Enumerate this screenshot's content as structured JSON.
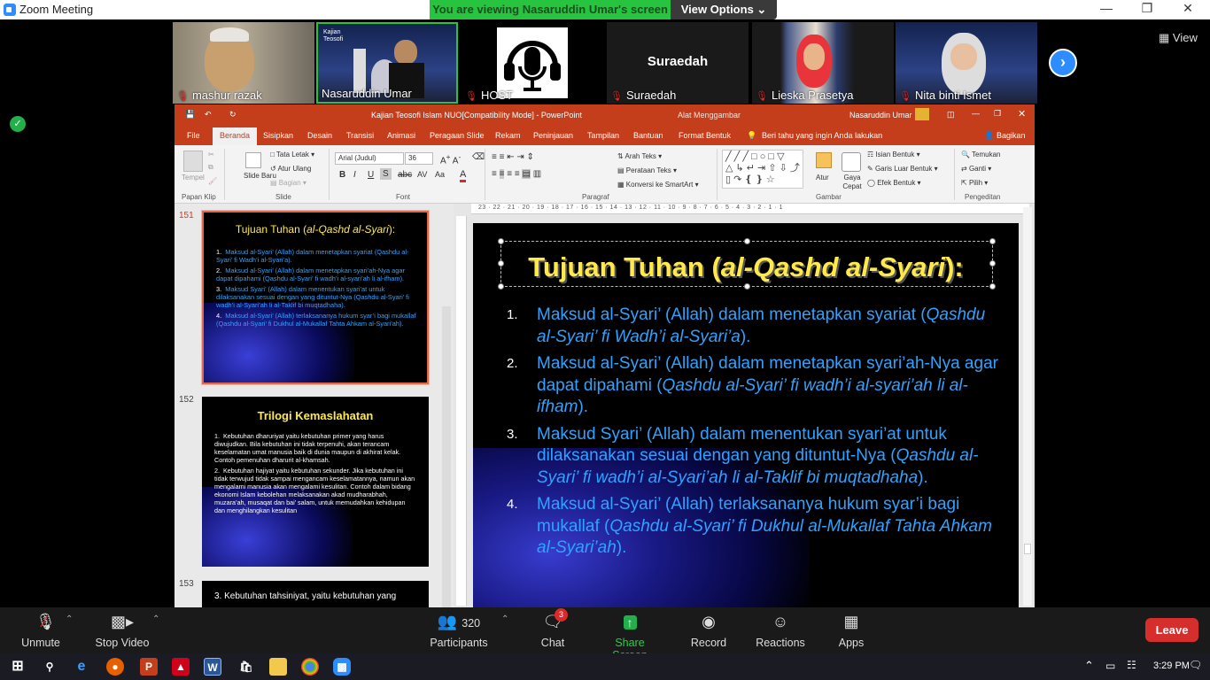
{
  "window": {
    "title": "Zoom Meeting"
  },
  "banner": {
    "viewing": "You are viewing Nasaruddin Umar's screen",
    "view_options": "View Options ⌄"
  },
  "participants_strip": [
    {
      "name": "mashur razak"
    },
    {
      "name": "Nasaruddin Umar"
    },
    {
      "name": "HOST"
    },
    {
      "name": "Suraedah",
      "big_label": "Suraedah"
    },
    {
      "name": "Lieska Prasetya"
    },
    {
      "name": "Nita binti Ismet"
    }
  ],
  "view_label": "View",
  "powerpoint": {
    "doc_title": "Kajian Teosofi Islam NUO[Compatibility Mode]  -  PowerPoint",
    "context_label": "Alat Menggambar",
    "user": "Nasaruddin Umar",
    "tabs": [
      "File",
      "Beranda",
      "Sisipkan",
      "Desain",
      "Transisi",
      "Animasi",
      "Peragaan Slide",
      "Rekam",
      "Peninjauan",
      "Tampilan",
      "Bantuan",
      "Format Bentuk"
    ],
    "tell_me": "Beri tahu yang ingin Anda lakukan",
    "share": "Bagikan",
    "ribbon": {
      "paste": "Tempel",
      "clipboard": "Papan Klip",
      "new_slide": "Slide Baru",
      "layout": "Tata Letak",
      "reset": "Atur Ulang",
      "section": "Bagian",
      "slide_group": "Slide",
      "font_name": "Arial (Judul)",
      "font_size": "36",
      "font_group": "Font",
      "text_dir": "Arah Teks",
      "align_text": "Perataan Teks",
      "smartart": "Konversi ke SmartArt",
      "paragraph_group": "Paragraf",
      "arrange": "Atur",
      "quick_styles": "Gaya Cepat",
      "shape_fill": "Isian Bentuk",
      "shape_outline": "Garis Luar Bentuk",
      "shape_effects": "Efek Bentuk",
      "drawing_group": "Gambar",
      "find": "Temukan",
      "replace": "Ganti",
      "select": "Pilih",
      "editing_group": "Pengeditan"
    },
    "thumbs": [
      {
        "num": "151",
        "title_a": "Tujuan Tuhan (",
        "title_b": "al-Qashd al-Syari",
        "title_c": "):",
        "items": [
          "Maksud al-Syari’ (Allah) dalam menetapkan syariat (Qashdu al-Syari’ fi Wadh’i al-Syari’a).",
          "Maksud al-Syari’ (Allah) dalam menetapkan syari’ah-Nya agar dapat dipahami (Qashdu al-Syari’ fi wadh’i al-syari’ah li al-ifham).",
          "Maksud Syari’ (Allah) dalam menentukan syari’at untuk dilaksanakan sesuai dengan yang dituntut-Nya (Qashdu al-Syari’ fi wadh’i al-Syari’ah li al-Taklif bi muqtadhaha).",
          "Maksud al-Syari’ (Allah) terlaksananya hukum syar’i bagi mukallaf (Qashdu al-Syari’ fi Dukhul al-Mukallaf Tahta Ahkam al-Syari’ah)."
        ]
      },
      {
        "num": "152",
        "title": "Trilogi Kemaslahatan",
        "items": [
          "Kebutuhan dharuriyat yaitu kebutuhan primer yang harus diwujudkan. Bila kebutuhan ini tidak terpenuhi, akan terancam keselamatan umat manusia baik di dunia maupun di akhirat kelak. Contoh pemenuhan dharurit al-khamsah.",
          "Kebutuhan hajiyat yaitu kebutuhan sekunder. Jika kebutuhan ini tidak terwujud tidak sampai mengancam keselamatannya, namun akan mengalami manusia akan mengalami kesulitan. Contoh dalam bidang ekonomi Islam kebolehan melaksanakan akad mudharabhah, muzara’ah, musaqat dan bai’ salam, untuk memudahkan kehidupan dan menghilangkan kesulitan"
        ]
      },
      {
        "num": "153",
        "item": "3. Kebutuhan tahsiniyat, yaitu kebutuhan yang"
      }
    ],
    "slide": {
      "title_a": "Tujuan Tuhan (",
      "title_b": "al-Qashd al-Syari",
      "title_c": "):",
      "items": [
        {
          "n": "1.",
          "a": "Maksud al-Syari’ (Allah) dalam menetapkan syariat (",
          "b": "Qashdu al-Syari’ fi Wadh’i al-Syari’a",
          "c": ")."
        },
        {
          "n": "2.",
          "a": "Maksud al-Syari’ (Allah) dalam menetapkan syari’ah-Nya agar dapat dipahami (",
          "b": "Qashdu al-Syari’ fi wadh’i al-syari’ah li al-ifham",
          "c": ")."
        },
        {
          "n": "3.",
          "a": "Maksud Syari’ (Allah) dalam menentukan syari’at untuk dilaksanakan sesuai dengan yang dituntut-Nya (",
          "b": "Qashdu al-Syari’ fi wadh’i al-Syari’ah li al-Taklif bi muqtadhaha",
          "c": ")."
        },
        {
          "n": "4.",
          "a": "Maksud al-Syari’ (Allah) terlaksananya hukum syar’i bagi mukallaf (",
          "b": "Qashdu al-Syari’ fi Dukhul al-Mukallaf Tahta Ahkam al-Syari’ah",
          "c": ")."
        }
      ]
    },
    "ruler": "23 · 22 · 21 · 20 · 19 · 18 · 17 · 16 · 15 · 14 · 13 · 12 · 11 · 10 · 9 · 8 · 7 · 6 · 5 · 4 · 3 · 2 · 1 · 1"
  },
  "toolbar": {
    "unmute": "Unmute",
    "stop_video": "Stop Video",
    "participants": "Participants",
    "participants_count": "320",
    "chat": "Chat",
    "chat_badge": "3",
    "share_screen": "Share Screen",
    "record": "Record",
    "reactions": "Reactions",
    "apps": "Apps",
    "leave": "Leave"
  },
  "clock": "3:29 PM",
  "colors": {
    "zoom_blue": "#2d8cff",
    "share_green": "#26c43f",
    "ppt_orange": "#c43e1c",
    "leave_red": "#d62d2d"
  }
}
